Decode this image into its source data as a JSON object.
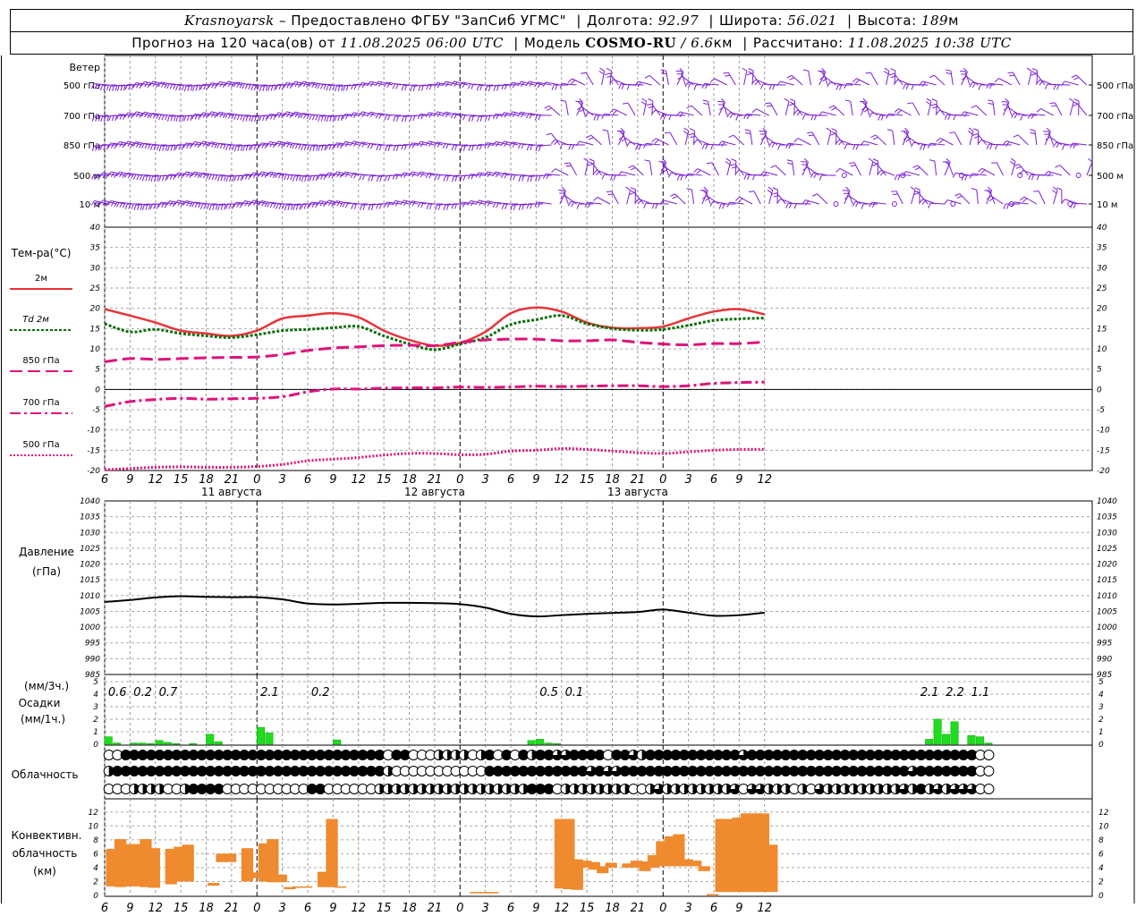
{
  "header": {
    "city": "Krasnoyarsk",
    "provider": "– Предоставлено ФГБУ \"ЗапСиб УГМС\"",
    "lon_label": "Долгота:",
    "lon": "92.97",
    "lat_label": "Широта:",
    "lat": "56.021",
    "alt_label": "Высота:",
    "alt": "189",
    "alt_unit": "м",
    "forecast_prefix": "Прогноз на 120 часа(ов) от",
    "forecast_start": "11.08.2025 06:00 UTC",
    "model_label": "Модель",
    "model_name": "COSMO-RU",
    "model_res": "/ 6.6",
    "model_res_unit": "км",
    "calc_label": "Рассчитано:",
    "calc_time": "11.08.2025 10:38 UTC"
  },
  "colors": {
    "wind": "#7a1fd6",
    "t2m": "#e8343a",
    "td2m": "#0a6e0a",
    "t850": "#e0127a",
    "t700": "#e0127a",
    "t500": "#e0127a",
    "precip": "#1fdc1f",
    "conv": "#ef8a2e",
    "pressure": "#000000"
  },
  "wind_panel": {
    "title": "Ветер",
    "levels": [
      "500 гПа",
      "700 гПа",
      "850 гПа",
      "500 м",
      "10  м"
    ]
  },
  "temp_panel": {
    "title": "Тем-ра(°C)",
    "legend": [
      {
        "label": "2м",
        "style": "solid"
      },
      {
        "label": "Td  2м",
        "style": "dotted-green"
      },
      {
        "label": "850 гПа",
        "style": "dashed"
      },
      {
        "label": "700 гПа",
        "style": "dashdot"
      },
      {
        "label": "500 гПа",
        "style": "dotted"
      }
    ]
  },
  "pressure_panel": {
    "title": "Давление",
    "unit": "(гПа)"
  },
  "precip_panel": {
    "unit3h": "(мм/3ч.)",
    "title": "Осадки",
    "unit1h": "(мм/1ч.)"
  },
  "cloud_panel": {
    "title": "Облачность"
  },
  "conv_panel": {
    "title_1": "Конвективн.",
    "title_2": "облачность",
    "unit": "(км)"
  },
  "date_labels": [
    "11 августа",
    "12 августа",
    "13 августа"
  ],
  "chart_data": [
    {
      "type": "line",
      "panel": "temperature",
      "x_hours": [
        6,
        9,
        12,
        15,
        18,
        21,
        0,
        3,
        6,
        9,
        12,
        15,
        18,
        21,
        0,
        3,
        6,
        9,
        12,
        15,
        18,
        21,
        0,
        3,
        6,
        9,
        12
      ],
      "ylim": [
        -20,
        40
      ],
      "yticks": [
        -20,
        -15,
        -10,
        -5,
        0,
        5,
        10,
        15,
        20,
        25,
        30,
        35,
        40
      ],
      "series": [
        {
          "name": "2м",
          "values": [
            19.8,
            18.2,
            16.5,
            14.5,
            13.8,
            13.2,
            14.5,
            17.5,
            18.2,
            18.8,
            17.8,
            14.5,
            12.2,
            10.8,
            11.5,
            14.2,
            18.8,
            20.2,
            19.2,
            16.5,
            15.2,
            15.1,
            15.5,
            17.5,
            19.2,
            19.8,
            18.5
          ]
        },
        {
          "name": "Td  2м",
          "values": [
            16.2,
            14.2,
            14.8,
            13.8,
            13.2,
            12.8,
            13.5,
            14.5,
            14.8,
            15.2,
            15.5,
            13.2,
            11.2,
            9.8,
            11.2,
            12.8,
            16.0,
            17.2,
            18.2,
            16.2,
            15.0,
            14.6,
            14.8,
            15.8,
            17.0,
            17.4,
            17.6
          ]
        },
        {
          "name": "850 гПа",
          "values": [
            6.8,
            7.6,
            7.4,
            7.6,
            7.8,
            7.9,
            8.0,
            8.6,
            9.6,
            10.2,
            10.5,
            10.8,
            10.9,
            10.8,
            11.6,
            12.2,
            12.4,
            12.4,
            12.0,
            12.0,
            12.2,
            11.6,
            11.2,
            11.0,
            11.3,
            11.3,
            11.7
          ]
        },
        {
          "name": "700 гПа",
          "values": [
            -4.2,
            -3.0,
            -2.5,
            -2.2,
            -2.4,
            -2.3,
            -2.2,
            -1.8,
            -0.6,
            0.1,
            0.1,
            0.3,
            0.4,
            0.4,
            0.6,
            0.5,
            0.6,
            0.8,
            0.7,
            0.8,
            0.9,
            0.9,
            0.7,
            0.9,
            1.5,
            1.7,
            1.8
          ]
        },
        {
          "name": "500 гПа",
          "values": [
            -19.8,
            -19.5,
            -19.2,
            -19.1,
            -19.2,
            -19.2,
            -19.0,
            -18.5,
            -17.6,
            -17.2,
            -16.8,
            -16.2,
            -15.8,
            -15.8,
            -16.1,
            -16.0,
            -15.2,
            -15.0,
            -14.6,
            -14.8,
            -15.2,
            -15.6,
            -15.8,
            -15.4,
            -15.0,
            -14.8,
            -14.8
          ]
        }
      ]
    },
    {
      "type": "line",
      "panel": "pressure",
      "x_hours": [
        6,
        9,
        12,
        15,
        18,
        21,
        0,
        3,
        6,
        9,
        12,
        15,
        18,
        21,
        0,
        3,
        6,
        9,
        12,
        15,
        18,
        21,
        0,
        3,
        6,
        9,
        12
      ],
      "ylim": [
        985,
        1040
      ],
      "yticks": [
        985,
        990,
        995,
        1000,
        1005,
        1010,
        1015,
        1020,
        1025,
        1030,
        1035,
        1040
      ],
      "series": [
        {
          "name": "",
          "values": [
            1008.0,
            1008.6,
            1009.4,
            1009.8,
            1009.6,
            1009.5,
            1009.5,
            1008.8,
            1007.5,
            1007.2,
            1007.4,
            1007.7,
            1007.7,
            1007.6,
            1007.3,
            1006.2,
            1004.2,
            1003.4,
            1003.8,
            1004.2,
            1004.5,
            1004.8,
            1005.6,
            1004.6,
            1003.6,
            1003.8,
            1004.6
          ]
        }
      ]
    },
    {
      "type": "bar",
      "panel": "precipitation",
      "ylim": [
        0,
        5
      ],
      "yticks": [
        0,
        1,
        2,
        3,
        4,
        5
      ],
      "hourly": [
        {
          "h": 0,
          "v": 0.6
        },
        {
          "h": 1,
          "v": 0.1
        },
        {
          "h": 3,
          "v": 0.1
        },
        {
          "h": 4,
          "v": 0.1
        },
        {
          "h": 5,
          "v": 0.05
        },
        {
          "h": 6,
          "v": 0.3
        },
        {
          "h": 7,
          "v": 0.15
        },
        {
          "h": 8,
          "v": 0.05
        },
        {
          "h": 10,
          "v": 0.05
        },
        {
          "h": 12,
          "v": 0.8
        },
        {
          "h": 13,
          "v": 0.2
        },
        {
          "h": 18,
          "v": 1.35
        },
        {
          "h": 19,
          "v": 0.9
        },
        {
          "h": 27,
          "v": 0.35
        },
        {
          "h": 50,
          "v": 0.3
        },
        {
          "h": 51,
          "v": 0.4
        },
        {
          "h": 52,
          "v": 0.1
        },
        {
          "h": 53,
          "v": 0.05
        },
        {
          "h": 97,
          "v": 0.4
        },
        {
          "h": 98,
          "v": 2.0
        },
        {
          "h": 99,
          "v": 0.8
        },
        {
          "h": 100,
          "v": 1.8
        },
        {
          "h": 102,
          "v": 0.7
        },
        {
          "h": 103,
          "v": 0.6
        },
        {
          "h": 104,
          "v": 0.1
        }
      ],
      "totals_3h": [
        {
          "label": "0.6",
          "h": 1.5
        },
        {
          "label": "0.2",
          "h": 4.5
        },
        {
          "label": "0.7",
          "h": 7.5
        },
        {
          "label": "2.1",
          "h": 19.5
        },
        {
          "label": "0.2",
          "h": 25.5
        },
        {
          "label": "0.5",
          "h": 52.5
        },
        {
          "label": "0.1",
          "h": 55.5
        },
        {
          "label": "2.1",
          "h": 97.5
        },
        {
          "label": "2.2",
          "h": 100.5
        },
        {
          "label": "1.1",
          "h": 103.5
        }
      ]
    },
    {
      "type": "table",
      "panel": "cloudiness",
      "symbol_key": "0 empty, 1 vertical half, 2 three-quarter, 3 full",
      "high": "0033333333333333333333333333333330330001111013030313322333303321333333333332333333333333333333333333333",
      "mid": "1333333333333333333333333333333331000000000003333333333332322333333333333333333333333333333333323333333",
      "low": "0001111001333300000000003300000011111111111111111133301111111100121111111120221110102111111111213121222"
    },
    {
      "type": "bar",
      "panel": "convective_cloud",
      "ylim": [
        0,
        13
      ],
      "yticks": [
        0,
        2,
        4,
        6,
        8,
        10,
        12
      ],
      "layers": [
        {
          "h": 0.5,
          "base": 1.3,
          "top": 6.7
        },
        {
          "h": 1.5,
          "base": 1.2,
          "top": 8.1
        },
        {
          "h": 2.5,
          "base": 1.3,
          "top": 7.4
        },
        {
          "h": 3.5,
          "base": 1.3,
          "top": 7.4
        },
        {
          "h": 4.5,
          "base": 1.2,
          "top": 8.1
        },
        {
          "h": 5.5,
          "base": 1.1,
          "top": 6.8
        },
        {
          "h": 7.5,
          "base": 1.6,
          "top": 6.7
        },
        {
          "h": 8.5,
          "base": 2.0,
          "top": 7.0
        },
        {
          "h": 9.5,
          "base": 2.0,
          "top": 7.3
        },
        {
          "h": 12.5,
          "base": 1.4,
          "top": 1.8
        },
        {
          "h": 13.5,
          "base": 4.8,
          "top": 6.0
        },
        {
          "h": 14.5,
          "base": 4.8,
          "top": 6.0
        },
        {
          "h": 16.5,
          "base": 2.0,
          "top": 6.8
        },
        {
          "h": 17.5,
          "base": 2.5,
          "top": 3.3
        },
        {
          "h": 18.5,
          "base": 2.0,
          "top": 7.5
        },
        {
          "h": 19.5,
          "base": 1.9,
          "top": 8.1
        },
        {
          "h": 20.5,
          "base": 1.9,
          "top": 3.0
        },
        {
          "h": 21.5,
          "base": 0.9,
          "top": 1.2
        },
        {
          "h": 22.5,
          "base": 1.1,
          "top": 1.3
        },
        {
          "h": 23.5,
          "base": 1.1,
          "top": 1.3
        },
        {
          "h": 25.5,
          "base": 1.2,
          "top": 3.4
        },
        {
          "h": 26.5,
          "base": 1.2,
          "top": 11.0
        },
        {
          "h": 27.5,
          "base": 1.1,
          "top": 1.3
        },
        {
          "h": 43.5,
          "base": 0.3,
          "top": 0.5
        },
        {
          "h": 44.5,
          "base": 0.3,
          "top": 0.5
        },
        {
          "h": 45.5,
          "base": 0.3,
          "top": 0.5
        },
        {
          "h": 53.5,
          "base": 1.0,
          "top": 11.0
        },
        {
          "h": 54.5,
          "base": 0.9,
          "top": 11.0
        },
        {
          "h": 55.5,
          "base": 0.8,
          "top": 5.2
        },
        {
          "h": 56.5,
          "base": 4.0,
          "top": 5.0
        },
        {
          "h": 57.5,
          "base": 3.7,
          "top": 4.8
        },
        {
          "h": 58.5,
          "base": 3.2,
          "top": 4.2
        },
        {
          "h": 59.5,
          "base": 4.0,
          "top": 4.7
        },
        {
          "h": 61.5,
          "base": 4.0,
          "top": 4.6
        },
        {
          "h": 62.5,
          "base": 4.0,
          "top": 5.0
        },
        {
          "h": 63.5,
          "base": 3.5,
          "top": 4.9
        },
        {
          "h": 64.5,
          "base": 4.0,
          "top": 5.8
        },
        {
          "h": 65.5,
          "base": 4.2,
          "top": 7.8
        },
        {
          "h": 66.5,
          "base": 4.2,
          "top": 8.5
        },
        {
          "h": 67.5,
          "base": 4.2,
          "top": 8.8
        },
        {
          "h": 68.5,
          "base": 4.2,
          "top": 5.2
        },
        {
          "h": 69.5,
          "base": 4.2,
          "top": 5.0
        },
        {
          "h": 70.5,
          "base": 3.5,
          "top": 4.2
        },
        {
          "h": 71.5,
          "base": 0.0,
          "top": 0.2
        },
        {
          "h": 72.5,
          "base": 0.5,
          "top": 11.0
        },
        {
          "h": 73.5,
          "base": 0.5,
          "top": 11.0
        },
        {
          "h": 74.5,
          "base": 0.5,
          "top": 11.2
        },
        {
          "h": 75.5,
          "base": 0.5,
          "top": 11.8
        },
        {
          "h": 76.5,
          "base": 0.5,
          "top": 11.8
        },
        {
          "h": 77.5,
          "base": 0.5,
          "top": 11.8
        },
        {
          "h": 78.5,
          "base": 0.5,
          "top": 7.3
        }
      ]
    }
  ]
}
